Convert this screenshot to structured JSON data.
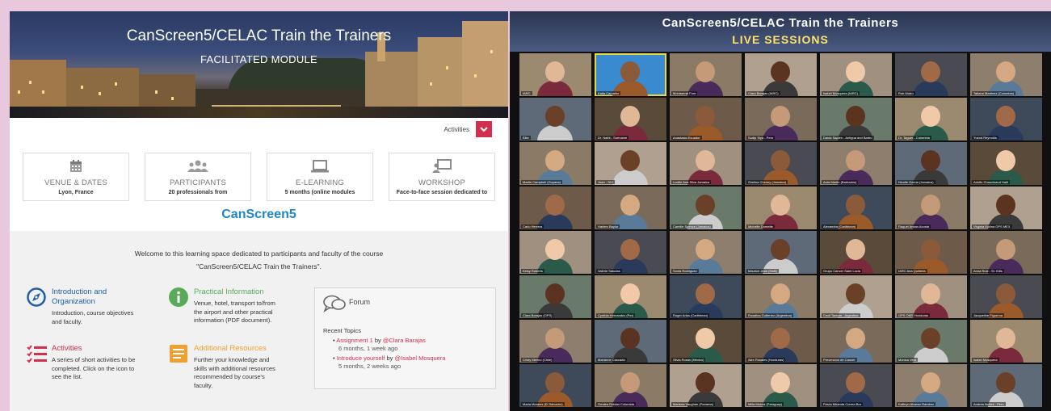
{
  "left_panel": {
    "banner": {
      "title": "CanScreen5/CELAC Train the Trainers",
      "subtitle": "FACILITATED MODULE"
    },
    "activities": {
      "label": "Activities",
      "button_icon": "chevron-down-icon"
    },
    "cards": [
      {
        "icon": "calendar-icon",
        "title": "VENUE & DATES",
        "subtitle": "Lyon, France"
      },
      {
        "icon": "users-icon",
        "title": "PARTICIPANTS",
        "subtitle": "20 professionals from"
      },
      {
        "icon": "laptop-icon",
        "title": "E-LEARNING",
        "subtitle": "5 months (online modules"
      },
      {
        "icon": "presentation-icon",
        "title": "WORKSHOP",
        "subtitle": "Face-to-face session dedicated to"
      }
    ],
    "brand": "CanScreen5",
    "welcome_line1": "Welcome to this learning space dedicated to participants and faculty of the course",
    "welcome_line2": "\"CanScreen5/CELAC Train the Trainers\".",
    "sections": {
      "intro": {
        "heading_1": "Introduction and",
        "heading_2": "Organization",
        "desc_1": "Introduction, course objectives",
        "desc_2": "and faculty.",
        "color": "#1e5fa8"
      },
      "practical": {
        "heading": "Practical Information",
        "desc_1": "Venue, hotel, transport to/from",
        "desc_2": "the airport and other practical",
        "desc_3": "information (PDF document).",
        "color": "#5aaa5a"
      },
      "activities": {
        "heading": "Activities",
        "desc_1": "A series of short activities to be",
        "desc_2": "completed. Click on the icon to",
        "desc_3": "see the list.",
        "color": "#d2304e"
      },
      "resources": {
        "heading": "Additional Resources",
        "desc_1": "Further your knowledge and",
        "desc_2": "skills with additional resources",
        "desc_3": "recommended by course's",
        "desc_4": "faculty.",
        "color": "#f0a030"
      }
    },
    "forum": {
      "title": "Forum",
      "recent_label": "Recent Topics",
      "topics": [
        {
          "title": "Assignment 1",
          "by": "by",
          "user": "@Clara Barajas",
          "time": "6 months, 1 week ago"
        },
        {
          "title": "Introduce yourself",
          "by": "by",
          "user": "@Isabel Mosquera",
          "time": "5 months, 2 weeks ago"
        }
      ]
    }
  },
  "right_panel": {
    "title": "CanScreen5/CELAC  Train the Trainers",
    "subtitle": "LIVE SESSIONS",
    "participants": [
      "IARC",
      "Katia Carvalho",
      "Montserrat Fore",
      "Clara Barajas (IARC)",
      "Isabel Mosquera (IARC)",
      "Rob Mutru",
      "Tatiana Martinez (Colombia)",
      "Elke",
      "Dr. Nathi - Suriname",
      "Anastasia Ecuador",
      "Sudip Siya - Peru",
      "Dania Saplen - Antigua and Barbu",
      "Dr. Taguer - Colombia",
      "Yuzod Reynolds",
      "Martin Campbell (Guyana)",
      "Joan - SVI",
      "Lucille Ana Silva Jamaica",
      "Shelina Cheney (Jamaica)",
      "Anta Martin (Barbados)",
      "Nicolle Garcia (Jamaica)",
      "Adolfo Chauvinaud Haiti",
      "Carlo Herrera",
      "Harlem Baylor",
      "Camille Spence (Jamaica)",
      "Michelle Dumette",
      "Alexandra (Caribbean)",
      "Raquel Ansan Acosta",
      "Virginia Molina OPS MEX",
      "Keisy Roberts",
      "Valerie Saludas",
      "Sonia Rodriguez",
      "Maurice Jean (Haiti)",
      "Grupo Cancer Saint Lucia",
      "IARC Ana Quilterla",
      "Anna Ruiz - St. Kitts",
      "Clara Barajas (OPS)",
      "Cynthia Hernandez (Per)",
      "Roger Arias (Caribbean)",
      "Rosalina Gutierrez (Argentina)",
      "Cecil Tantum - Argentina",
      "OPS OMS Honduras",
      "Jacqueline Figueroa",
      "Cristy Merino (Chile)",
      "Marianne Cascada",
      "Silvia Rosas (Mexico)",
      "Alex Rosales (Honduras)",
      "Prevencion de Cancer",
      "Monica Vera",
      "Isabel Mosquera",
      "Maria Morales (El Salvador)",
      "Omaira Roldan Colombia",
      "Marlena Vaughan (Panama)",
      "Milla Murcia (Paraguay)",
      "Flavia Miranda Correa Bra",
      "Kathryn Alvarez Ramirez",
      "Andrea Nuñez - Peru"
    ],
    "active_tile": 1
  }
}
